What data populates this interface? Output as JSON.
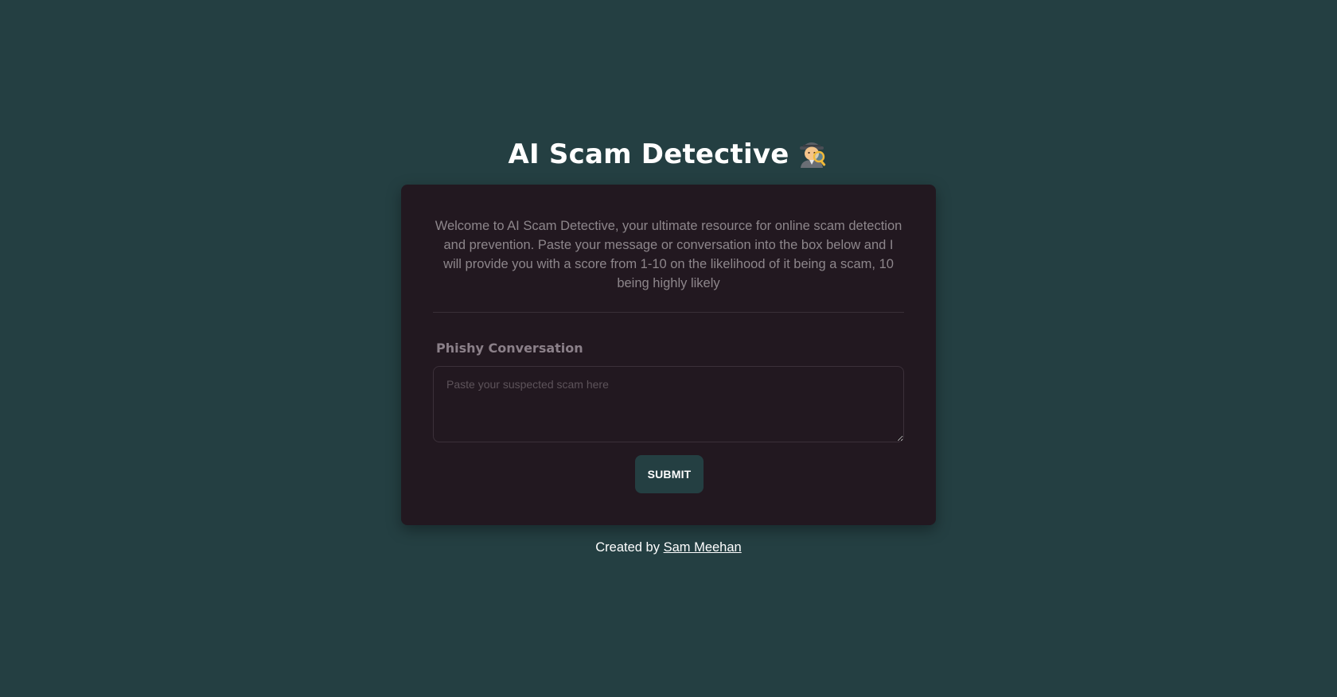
{
  "header": {
    "title": "AI Scam Detective",
    "title_icon": "detective-emoji-icon"
  },
  "card": {
    "intro_text": "Welcome to AI Scam Detective, your ultimate resource for online scam detection and prevention. Paste your message or conversation into the box below and I will provide you with a score from 1-10 on the likelihood of it being a scam, 10 being highly likely",
    "field_label": "Phishy Conversation",
    "input_placeholder": "Paste your suspected scam here",
    "input_value": "",
    "submit_label": "SUBMIT"
  },
  "footer": {
    "prefix": "Created by",
    "author_link": "Sam Meehan"
  },
  "colors": {
    "background": "#243f42",
    "card": "#221820",
    "button": "#243f42",
    "text_muted": "#8d868b"
  }
}
